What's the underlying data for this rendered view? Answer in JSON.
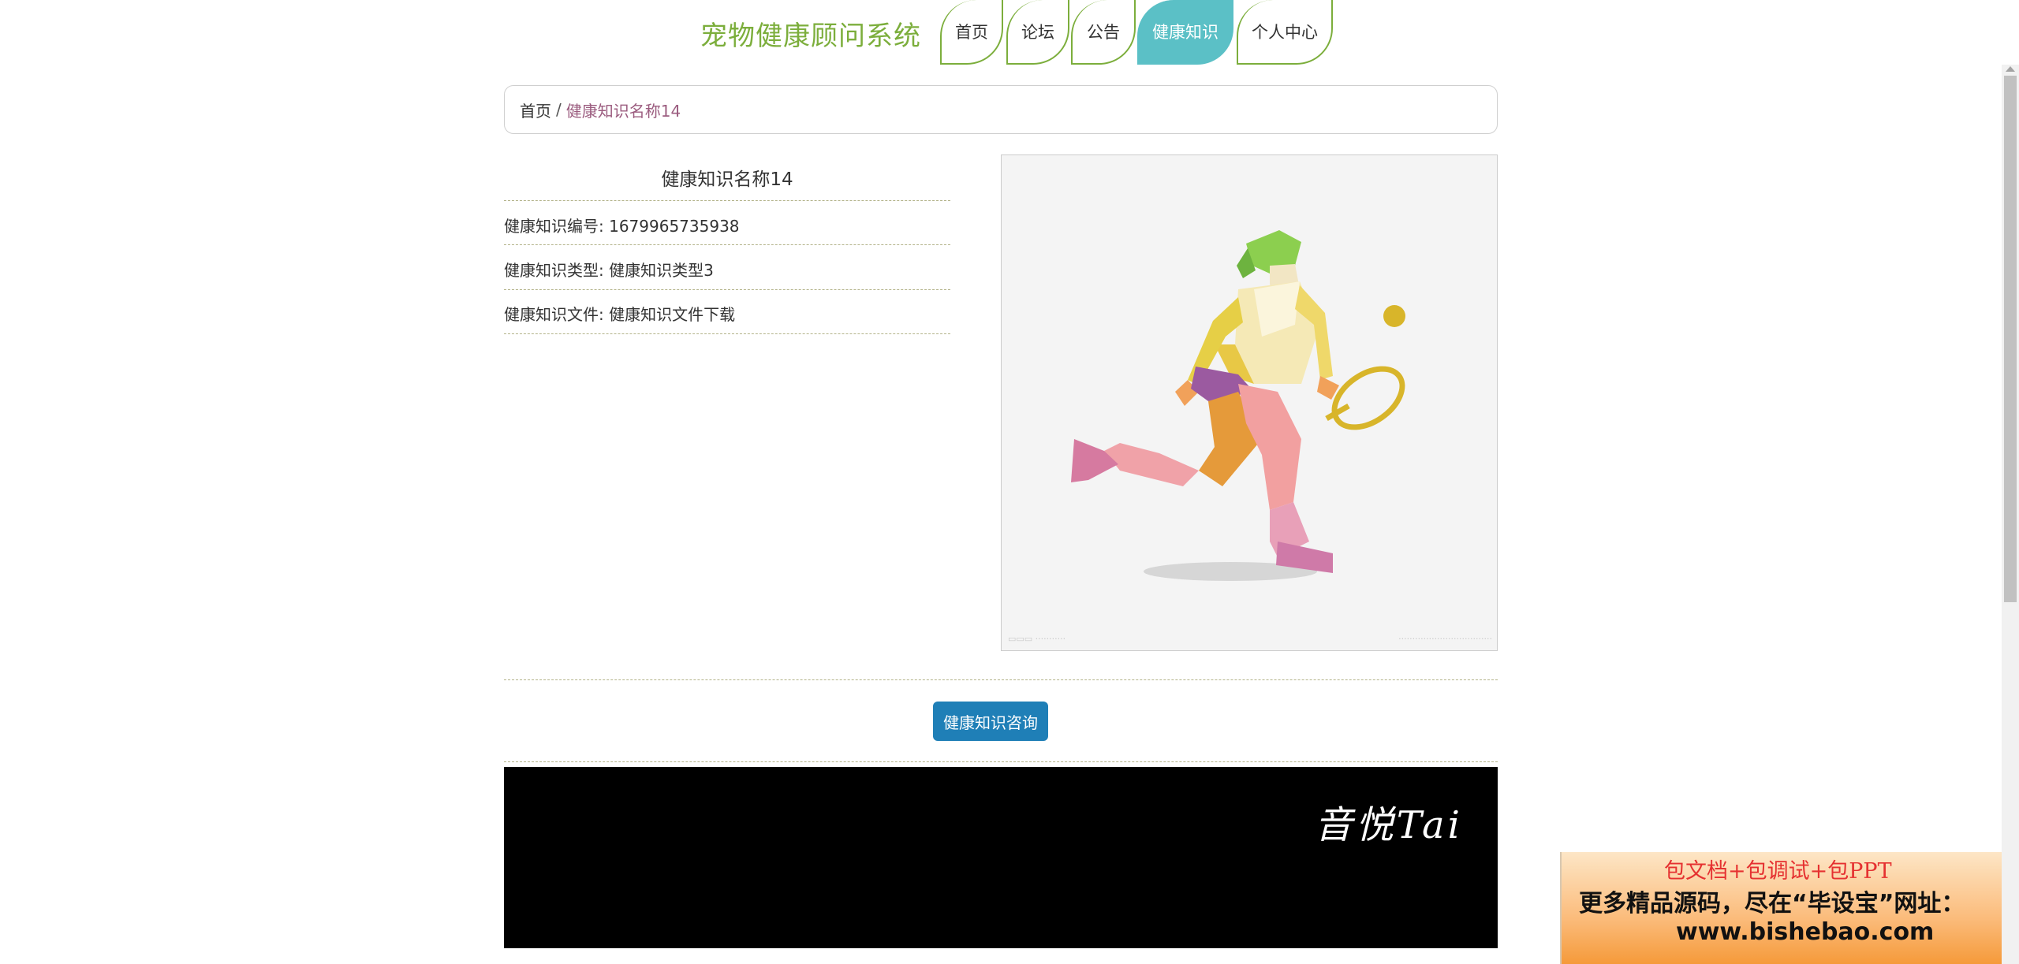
{
  "header": {
    "site_title": "宠物健康顾问系统",
    "nav": [
      {
        "label": "首页",
        "active": false
      },
      {
        "label": "论坛",
        "active": false
      },
      {
        "label": "公告",
        "active": false
      },
      {
        "label": "健康知识",
        "active": true
      },
      {
        "label": "个人中心",
        "active": false
      }
    ]
  },
  "breadcrumb": {
    "home": "首页",
    "separator": "/",
    "current": "健康知识名称14"
  },
  "detail": {
    "title": "健康知识名称14",
    "rows": [
      {
        "label": "健康知识编号:",
        "value": "1679965735938"
      },
      {
        "label": "健康知识类型:",
        "value": "健康知识类型3"
      },
      {
        "label": "健康知识文件:",
        "value": "健康知识文件下载"
      }
    ],
    "image_icon": "running-tennis-player-illustration",
    "consult_button": "健康知识咨询"
  },
  "video": {
    "signature": "音悦Tai"
  },
  "ad": {
    "line1": "包文档+包调试+包PPT",
    "line2": "更多精品源码，尽在“毕设宝”网址：",
    "line3": "www.bishebao.com"
  },
  "colors": {
    "brand_green": "#7cae3c",
    "active_tab": "#5bc0c6",
    "button_blue": "#1f7fb7",
    "breadcrumb_current": "#9b5c7f"
  }
}
